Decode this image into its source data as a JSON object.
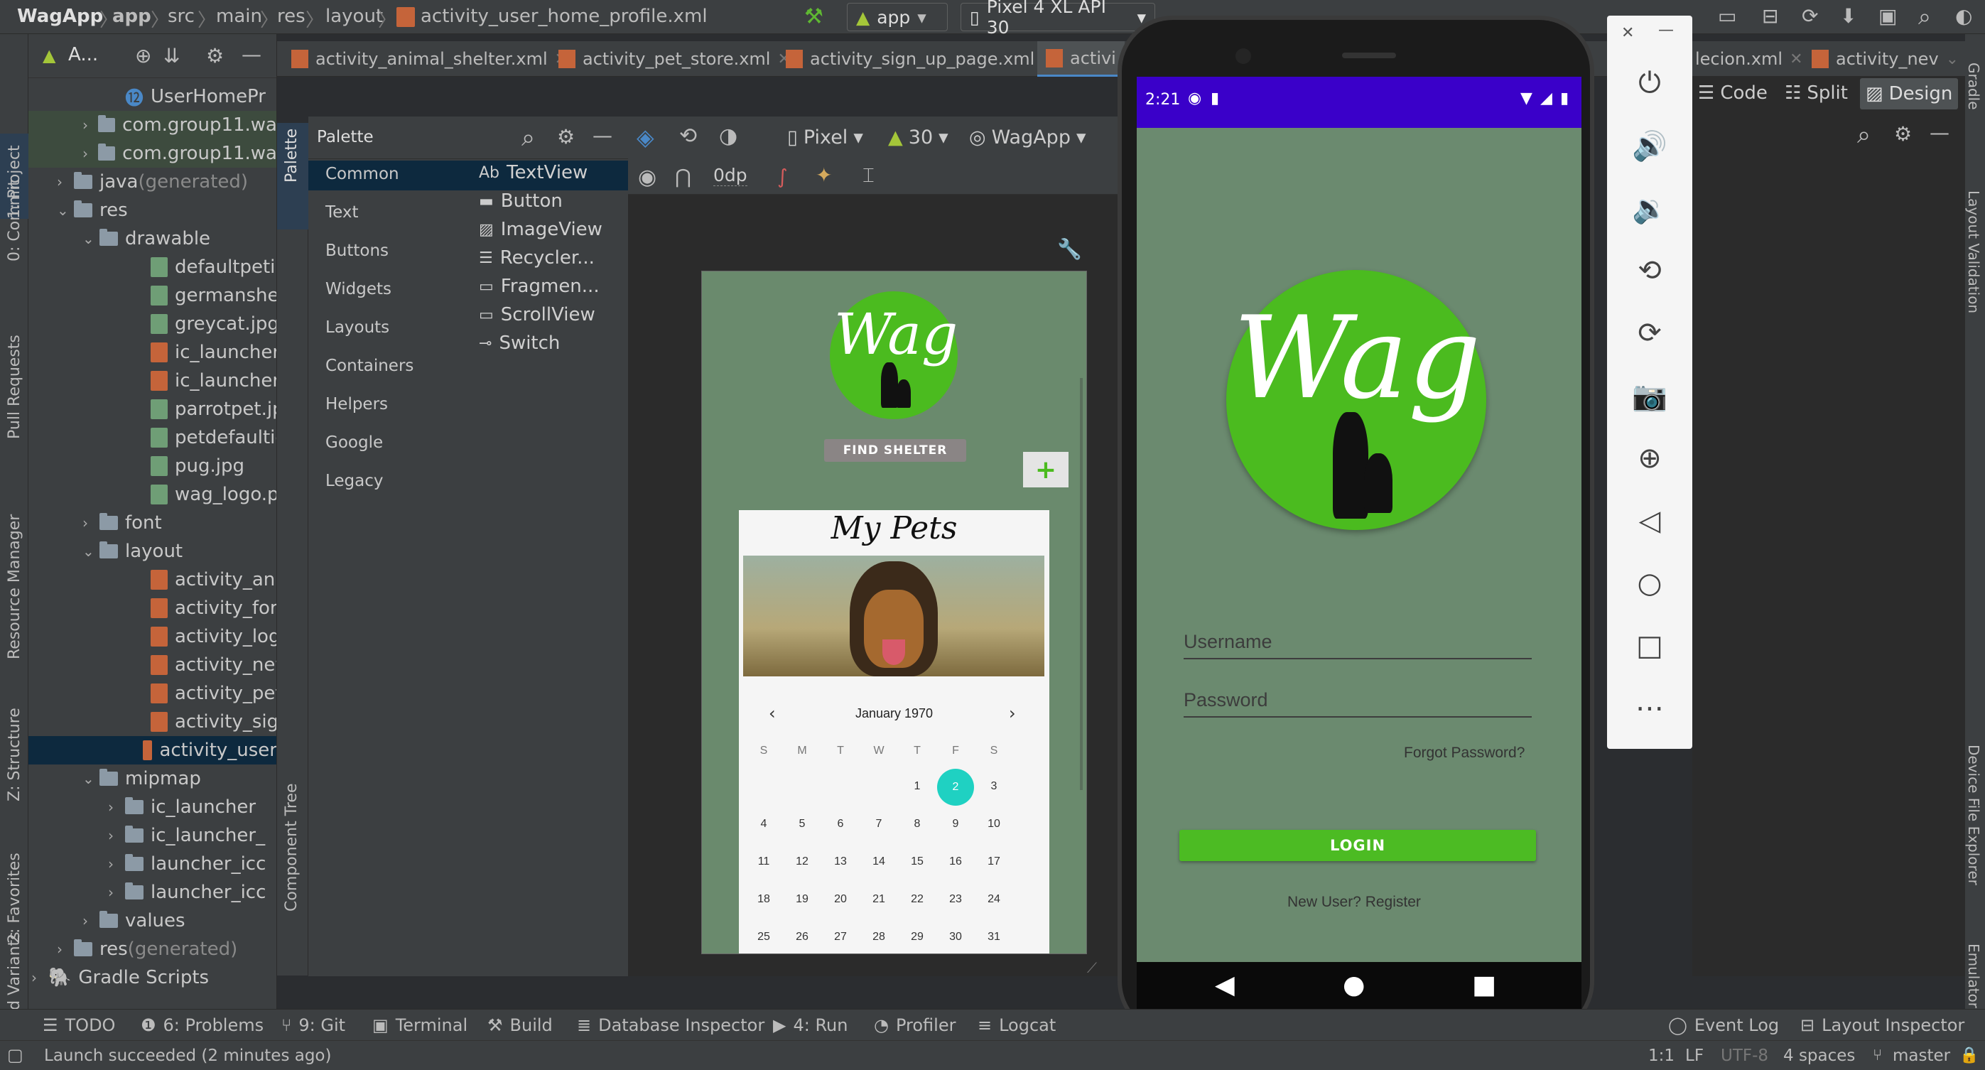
{
  "titlebar": {
    "breadcrumbs": [
      "WagApp",
      "app",
      "src",
      "main",
      "res",
      "layout",
      "activity_user_home_profile.xml"
    ],
    "run_config": "app",
    "device": "Pixel 4 XL API 30"
  },
  "editor_tabs": [
    {
      "label": "activity_animal_shelter.xml"
    },
    {
      "label": "activity_pet_store.xml"
    },
    {
      "label": "activity_sign_up_page.xml"
    },
    {
      "label": "activi"
    },
    {
      "label": "lecion.xml"
    },
    {
      "label": "activity_nev"
    }
  ],
  "view_modes": {
    "code": "Code",
    "split": "Split",
    "design": "Design"
  },
  "project": {
    "header": "A...",
    "items": [
      {
        "label": "UserHomePr",
        "indent": 3,
        "kind": "class"
      },
      {
        "label": "com.group11.wa",
        "indent": 2,
        "kind": "folder"
      },
      {
        "label": "com.group11.wa",
        "indent": 2,
        "kind": "folder"
      },
      {
        "label": "java",
        "suffix": " (generated)",
        "indent": 1,
        "kind": "folder"
      },
      {
        "label": "res",
        "indent": 1,
        "kind": "folder"
      },
      {
        "label": "drawable",
        "indent": 2,
        "kind": "folder"
      },
      {
        "label": "defaultpetim",
        "indent": 4,
        "kind": "img"
      },
      {
        "label": "germanshep",
        "indent": 4,
        "kind": "img"
      },
      {
        "label": "greycat.jpg",
        "indent": 4,
        "kind": "img"
      },
      {
        "label": "ic_launcher_",
        "indent": 4,
        "kind": "xml"
      },
      {
        "label": "ic_launcher_",
        "indent": 4,
        "kind": "xml"
      },
      {
        "label": "parrotpet.jpg",
        "indent": 4,
        "kind": "img"
      },
      {
        "label": "petdefaultic",
        "indent": 4,
        "kind": "img"
      },
      {
        "label": "pug.jpg",
        "indent": 4,
        "kind": "img"
      },
      {
        "label": "wag_logo.pr",
        "indent": 4,
        "kind": "img"
      },
      {
        "label": "font",
        "indent": 2,
        "kind": "folder"
      },
      {
        "label": "layout",
        "indent": 2,
        "kind": "folder"
      },
      {
        "label": "activity_anin",
        "indent": 4,
        "kind": "xml"
      },
      {
        "label": "activity_form",
        "indent": 4,
        "kind": "xml"
      },
      {
        "label": "activity_logii",
        "indent": 4,
        "kind": "xml"
      },
      {
        "label": "activity_new",
        "indent": 4,
        "kind": "xml"
      },
      {
        "label": "activity_pet_",
        "indent": 4,
        "kind": "xml"
      },
      {
        "label": "activity_sign",
        "indent": 4,
        "kind": "xml"
      },
      {
        "label": "activity_user",
        "indent": 4,
        "kind": "xml"
      },
      {
        "label": "mipmap",
        "indent": 2,
        "kind": "folder"
      },
      {
        "label": "ic_launcher",
        "indent": 3,
        "kind": "folder"
      },
      {
        "label": "ic_launcher_",
        "indent": 3,
        "kind": "folder"
      },
      {
        "label": "launcher_icc",
        "indent": 3,
        "kind": "folder"
      },
      {
        "label": "launcher_icc",
        "indent": 3,
        "kind": "folder"
      },
      {
        "label": "values",
        "indent": 2,
        "kind": "folder"
      },
      {
        "label": "res",
        "suffix": " (generated)",
        "indent": 1,
        "kind": "folder"
      },
      {
        "label": "Gradle Scripts",
        "indent": 0,
        "kind": "gradle"
      }
    ]
  },
  "left_tabs": [
    "1: Project",
    "0: Commit",
    "Pull Requests",
    "Resource Manager",
    "Z: Structure",
    "2: Favorites",
    "uild Variants"
  ],
  "palette": {
    "title": "Palette",
    "tab_label": "Palette",
    "tree_label": "Component Tree",
    "categories": [
      "Common",
      "Text",
      "Buttons",
      "Widgets",
      "Layouts",
      "Containers",
      "Helpers",
      "Google",
      "Legacy"
    ],
    "widgets": [
      {
        "icon": "Ab",
        "label": "TextView"
      },
      {
        "icon": "btn",
        "label": "Button"
      },
      {
        "icon": "img",
        "label": "ImageView"
      },
      {
        "icon": "list",
        "label": "Recycler..."
      },
      {
        "icon": "frag",
        "label": "Fragmen..."
      },
      {
        "icon": "scroll",
        "label": "ScrollView"
      },
      {
        "icon": "switch",
        "label": "Switch"
      }
    ]
  },
  "design_toolbar": {
    "device": "Pixel",
    "api": "30",
    "theme": "WagApp",
    "margin": "0dp"
  },
  "preview": {
    "logo_text": "Wag",
    "find_shelter": "FIND SHELTER",
    "add": "+",
    "my_pets": "My Pets",
    "calendar": {
      "month": "January 1970",
      "weekdays": [
        "S",
        "M",
        "T",
        "W",
        "T",
        "F",
        "S"
      ],
      "weeks": [
        [
          "",
          "",
          "",
          "",
          "1",
          "2",
          "3"
        ],
        [
          "4",
          "5",
          "6",
          "7",
          "8",
          "9",
          "10"
        ],
        [
          "11",
          "12",
          "13",
          "14",
          "15",
          "16",
          "17"
        ],
        [
          "18",
          "19",
          "20",
          "21",
          "22",
          "23",
          "24"
        ],
        [
          "25",
          "26",
          "27",
          "28",
          "29",
          "30",
          "31"
        ]
      ],
      "selected": "2"
    }
  },
  "emulator": {
    "time": "2:21",
    "logo_text": "Wag",
    "username_placeholder": "Username",
    "password_placeholder": "Password",
    "forgot": "Forgot Password?",
    "login": "LOGIN",
    "register": "New User? Register"
  },
  "right_tabs": [
    "Gradle",
    "Layout Validation",
    "Device File Explorer",
    "Emulator"
  ],
  "bottom_tools": [
    {
      "label": "TODO"
    },
    {
      "label": "6: Problems"
    },
    {
      "label": "9: Git"
    },
    {
      "label": "Terminal"
    },
    {
      "label": "Build"
    },
    {
      "label": "Database Inspector"
    },
    {
      "label": "4: Run"
    },
    {
      "label": "Profiler"
    },
    {
      "label": "Logcat"
    },
    {
      "label": "Event Log"
    },
    {
      "label": "Layout Inspector"
    }
  ],
  "status": {
    "message": "Launch succeeded (2 minutes ago)",
    "position": "1:1",
    "line_sep": "LF",
    "encoding": "UTF-8",
    "indent": "4 spaces",
    "branch": "master"
  },
  "colors": {
    "ide_bg": "#3c3f41",
    "status_bar_purple": "#3a00c9",
    "app_bg": "#6b8a6f",
    "logo_green": "#4bbb1f",
    "login_green": "#4cbb23",
    "calendar_accent": "#1fd1c2"
  }
}
